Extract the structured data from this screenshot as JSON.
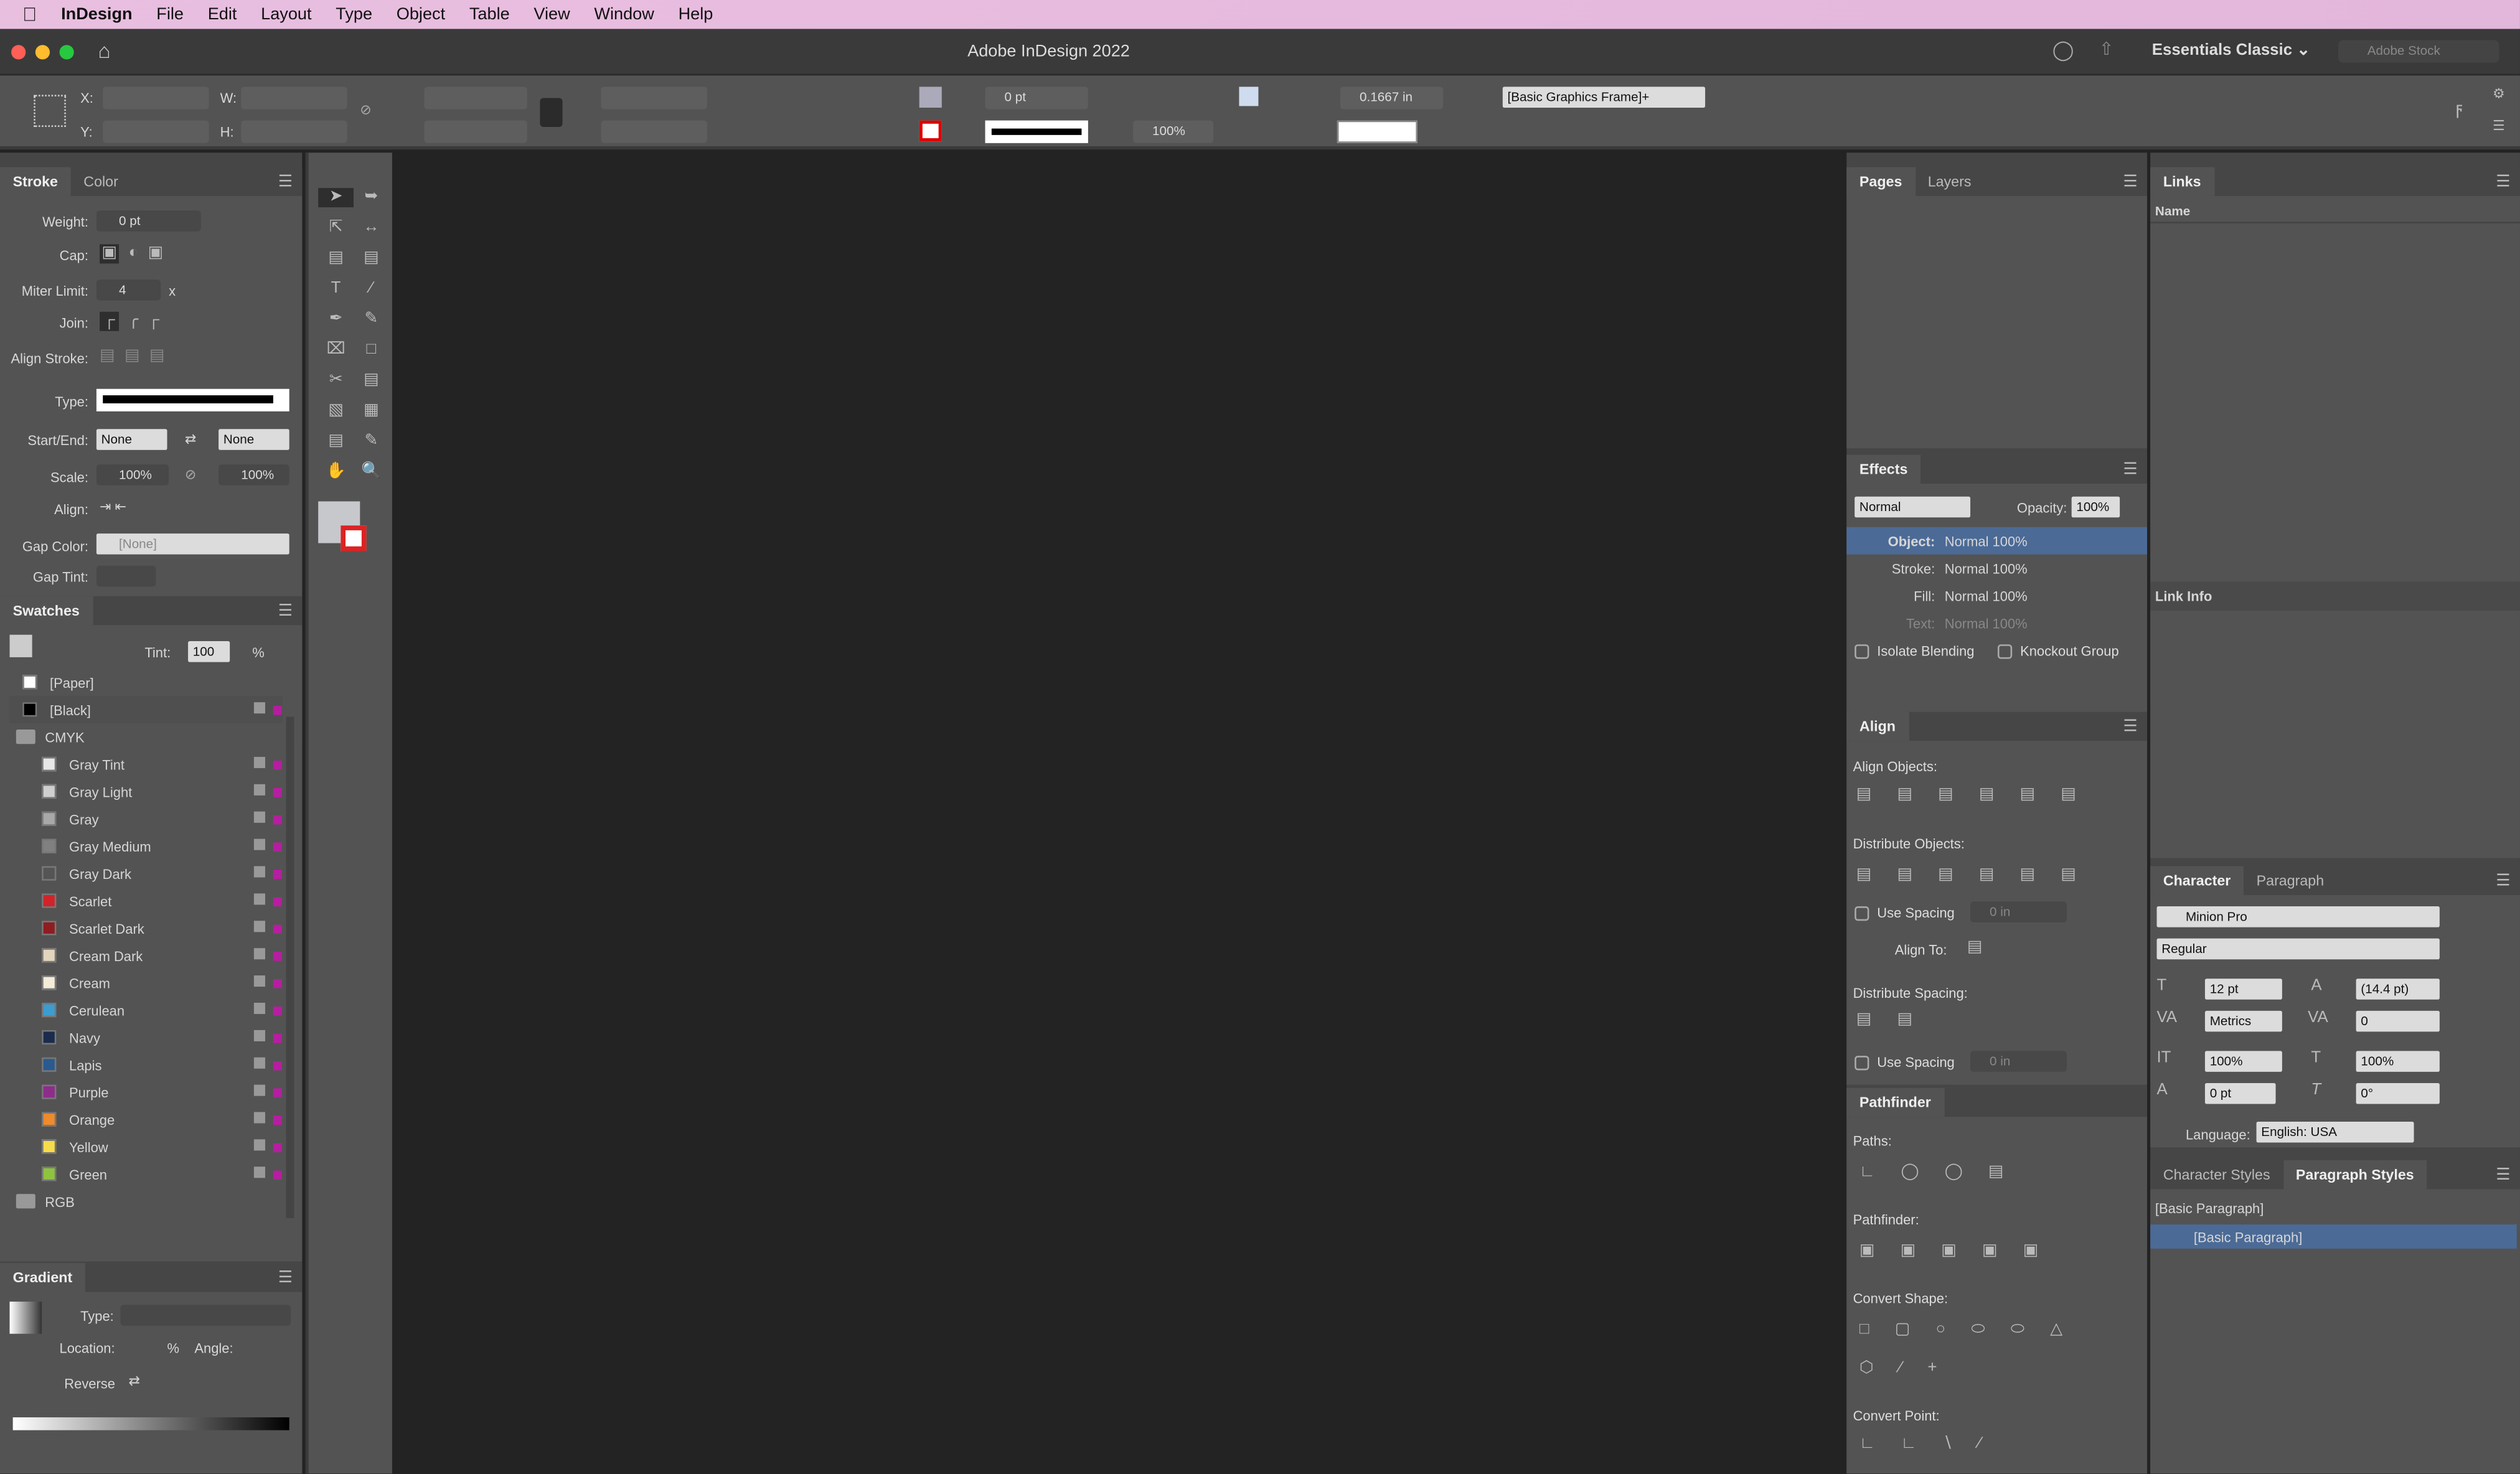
{
  "menubar": {
    "app": "InDesign",
    "items": [
      "File",
      "Edit",
      "Layout",
      "Type",
      "Object",
      "Table",
      "View",
      "Window",
      "Help"
    ]
  },
  "titlebar": {
    "title": "Adobe InDesign 2022",
    "workspace": "Essentials Classic",
    "search_placeholder": "Adobe Stock"
  },
  "control": {
    "x_label": "X:",
    "y_label": "Y:",
    "w_label": "W:",
    "h_label": "H:",
    "stroke_weight": "0 pt",
    "opacity": "100%",
    "stroke_offset": "0.1667 in",
    "object_style": "[Basic Graphics Frame]+"
  },
  "stroke": {
    "tabs": [
      "Stroke",
      "Color"
    ],
    "weight_label": "Weight:",
    "weight": "0 pt",
    "cap_label": "Cap:",
    "miter_label": "Miter Limit:",
    "miter": "4",
    "miter_unit": "x",
    "join_label": "Join:",
    "align_label": "Align Stroke:",
    "type_label": "Type:",
    "startend_label": "Start/End:",
    "start": "None",
    "end": "None",
    "scale_label": "Scale:",
    "scale1": "100%",
    "scale2": "100%",
    "align2_label": "Align:",
    "gapcolor_label": "Gap Color:",
    "gapcolor": "[None]",
    "gaptint_label": "Gap Tint:"
  },
  "swatches": {
    "title": "Swatches",
    "tint_label": "Tint:",
    "tint": "100",
    "tint_unit": "%",
    "items": [
      {
        "name": "[Paper]",
        "color": "#ffffff",
        "indent": 0
      },
      {
        "name": "[Black]",
        "color": "#000000",
        "indent": 0
      },
      {
        "name": "CMYK",
        "color": "",
        "indent": 0,
        "group": true
      },
      {
        "name": "Gray Tint",
        "color": "#e6e6e6",
        "indent": 1
      },
      {
        "name": "Gray Light",
        "color": "#cfcfcf",
        "indent": 1
      },
      {
        "name": "Gray",
        "color": "#a8a8a8",
        "indent": 1
      },
      {
        "name": "Gray Medium",
        "color": "#808080",
        "indent": 1
      },
      {
        "name": "Gray Dark",
        "color": "#555555",
        "indent": 1
      },
      {
        "name": "Scarlet",
        "color": "#d2232a",
        "indent": 1
      },
      {
        "name": "Scarlet Dark",
        "color": "#8e1c21",
        "indent": 1
      },
      {
        "name": "Cream Dark",
        "color": "#e3d5bd",
        "indent": 1
      },
      {
        "name": "Cream",
        "color": "#f4ecd9",
        "indent": 1
      },
      {
        "name": "Cerulean",
        "color": "#3d9ccf",
        "indent": 1
      },
      {
        "name": "Navy",
        "color": "#1a2b4c",
        "indent": 1
      },
      {
        "name": "Lapis",
        "color": "#2a5a8f",
        "indent": 1
      },
      {
        "name": "Purple",
        "color": "#8e2c8c",
        "indent": 1
      },
      {
        "name": "Orange",
        "color": "#ee8b2c",
        "indent": 1
      },
      {
        "name": "Yellow",
        "color": "#f7dc4a",
        "indent": 1
      },
      {
        "name": "Green",
        "color": "#8fc33f",
        "indent": 1
      },
      {
        "name": "RGB",
        "color": "",
        "indent": 0,
        "group": true
      }
    ]
  },
  "gradient": {
    "title": "Gradient",
    "type_label": "Type:",
    "location_label": "Location:",
    "location_unit": "%",
    "angle_label": "Angle:",
    "reverse_label": "Reverse"
  },
  "pages": {
    "tabs": [
      "Pages",
      "Layers"
    ]
  },
  "effects": {
    "title": "Effects",
    "mode": "Normal",
    "opacity_label": "Opacity:",
    "opacity": "100%",
    "rows": [
      {
        "label": "Object:",
        "value": "Normal 100%"
      },
      {
        "label": "Stroke:",
        "value": "Normal 100%"
      },
      {
        "label": "Fill:",
        "value": "Normal 100%"
      },
      {
        "label": "Text:",
        "value": "Normal 100%"
      }
    ],
    "isolate": "Isolate Blending",
    "knockout": "Knockout Group"
  },
  "align": {
    "title": "Align",
    "align_objects": "Align Objects:",
    "distribute_objects": "Distribute Objects:",
    "use_spacing": "Use Spacing",
    "spacing": "0 in",
    "align_to": "Align To:",
    "distribute_spacing": "Distribute Spacing:",
    "use_spacing2": "Use Spacing",
    "spacing2": "0 in"
  },
  "pathfinder": {
    "title": "Pathfinder",
    "paths": "Paths:",
    "pathfinder": "Pathfinder:",
    "convert_shape": "Convert Shape:",
    "convert_point": "Convert Point:"
  },
  "links": {
    "title": "Links",
    "name_col": "Name",
    "link_info": "Link Info"
  },
  "character": {
    "tabs": [
      "Character",
      "Paragraph"
    ],
    "font": "Minion Pro",
    "style": "Regular",
    "size": "12 pt",
    "leading": "(14.4 pt)",
    "kerning": "Metrics",
    "tracking": "0",
    "vscale": "100%",
    "hscale": "100%",
    "baseline": "0 pt",
    "skew": "0°",
    "language_label": "Language:",
    "language": "English: USA"
  },
  "styles": {
    "tabs": [
      "Character Styles",
      "Paragraph Styles"
    ],
    "current": "[Basic Paragraph]",
    "items": [
      "[Basic Paragraph]"
    ]
  },
  "colors": {
    "selection": "#4b6a96",
    "canvas": "#232323",
    "panel": "#535353"
  }
}
